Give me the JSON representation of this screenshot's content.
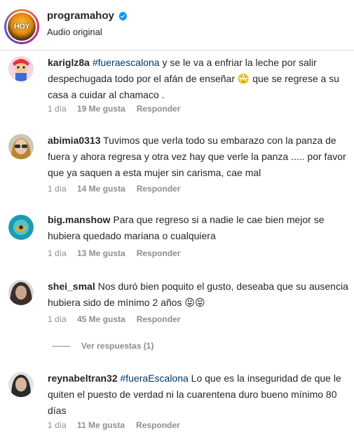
{
  "post": {
    "username": "programahoy",
    "subtitle": "Audio original",
    "avatar_text": "HOY"
  },
  "comments": [
    {
      "user": "kariglz8a",
      "tag": "#fueraescalona",
      "text_before_emoji": " y se le va a enfriar la leche por salir despechugada todo por el afán de enseñar ",
      "emoji": "🙄",
      "text_after_emoji": " que se regrese a su casa a cuidar al chamaco .",
      "time": "1 día",
      "likes": "19 Me gusta",
      "reply": "Responder"
    },
    {
      "user": "abimia0313",
      "text": "Tuvimos que verla todo su embarazo con la panza de fuera y ahora regresa y otra vez hay que verle la panza ..... por favor que ya saquen a esta mujer sin carisma, cae mal",
      "time": "1 día",
      "likes": "14 Me gusta",
      "reply": "Responder"
    },
    {
      "user": "big.manshow",
      "text": "Para que regreso si a nadie le cae bien mejor se hubiera quedado mariana o cualquiera",
      "time": "1 día",
      "likes": "13 Me gusta",
      "reply": "Responder"
    },
    {
      "user": "shei_smal",
      "text": "Nos duró bien poquito el gusto, deseaba que su ausencia hubiera sido de mínimo 2 años",
      "emoji": "😝😝",
      "time": "1 día",
      "likes": "45 Me gusta",
      "reply": "Responder",
      "view_replies": "Ver respuestas (1)"
    },
    {
      "user": "reynabeltran32",
      "tag": "#fueraEscalona",
      "text": " Lo que es la inseguridad de que le quiten el puesto de verdad ni la cuarentena duro bueno mínimo 80 días",
      "time": "1 día",
      "likes": "11 Me gusta",
      "reply": "Responder"
    }
  ],
  "colors": {
    "text": "#262626",
    "secondary": "#8e8e8e",
    "hashtag": "#00376b",
    "verified": "#0095f6",
    "divider": "#dbdbdb"
  },
  "icons": {
    "verified": "verified-badge-icon"
  }
}
